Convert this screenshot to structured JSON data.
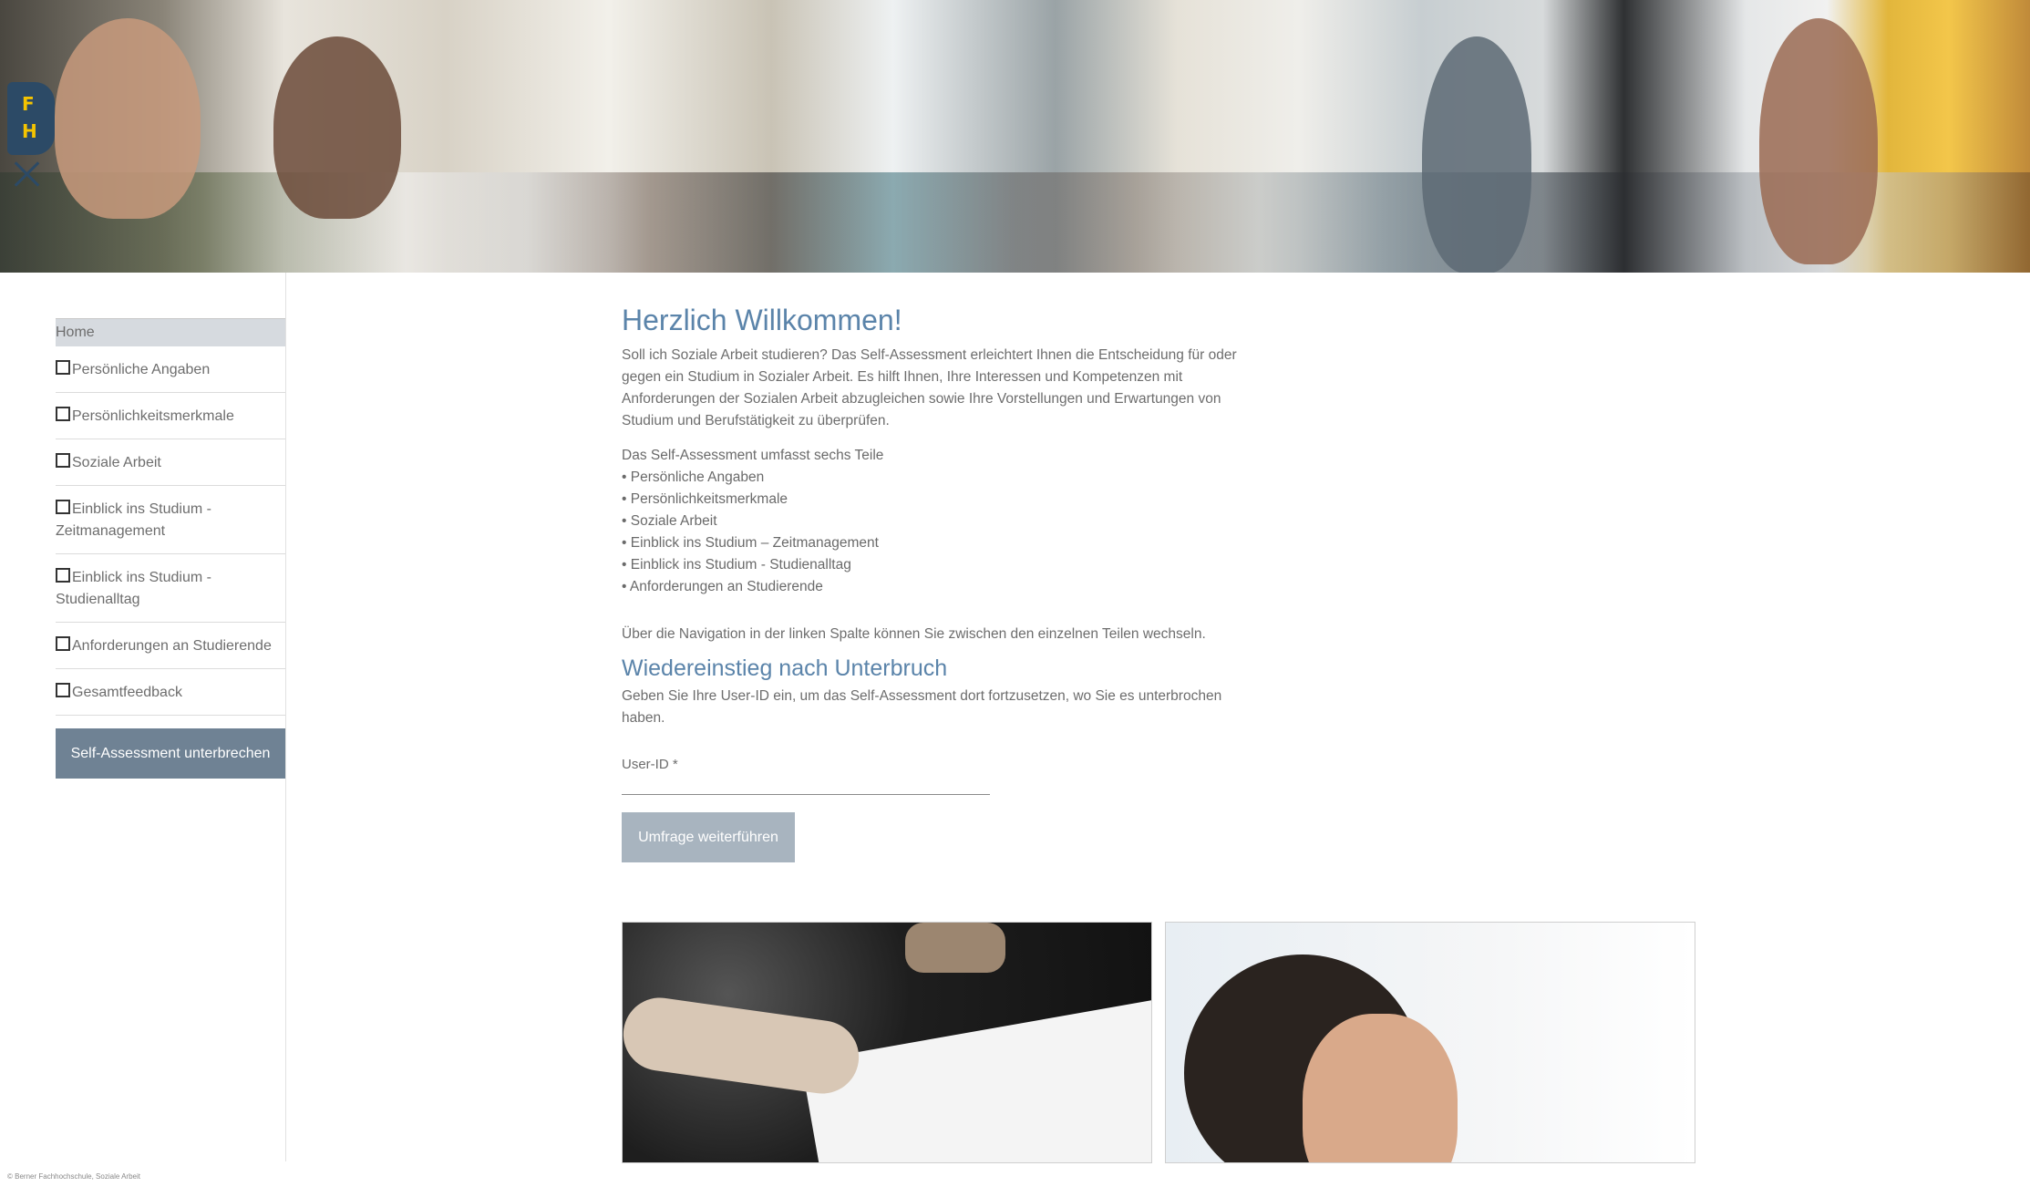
{
  "nav": {
    "home": "Home",
    "items": [
      {
        "label": "Persönliche Angaben"
      },
      {
        "label": "Persönlichkeitsmerkmale"
      },
      {
        "label": "Soziale Arbeit"
      },
      {
        "label": "Einblick ins Studium - Zeitmanagement"
      },
      {
        "label": "Einblick ins Studium - Studienalltag"
      },
      {
        "label": "Anforderungen an Studierende"
      },
      {
        "label": "Gesamtfeedback"
      }
    ],
    "pause_button": "Self-Assessment unterbrechen"
  },
  "logo": {
    "letter1": "F",
    "letter2": "H"
  },
  "main": {
    "title": "Herzlich Willkommen!",
    "intro": "Soll ich Soziale Arbeit studieren? Das Self-Assessment erleichtert Ihnen die Entscheidung für oder gegen ein Studium in Sozialer Arbeit. Es hilft Ihnen, Ihre Interessen und Kompetenzen mit Anforderungen der Sozialen Arbeit abzugleichen sowie Ihre Vorstellungen und Erwartungen von Studium und Berufstätigkeit zu überprüfen.",
    "parts_heading": "Das Self-Assessment umfasst sechs Teile",
    "parts": [
      "• Persönliche Angaben",
      "• Persönlichkeitsmerkmale",
      "• Soziale Arbeit",
      "• Einblick ins Studium – Zeitmanagement",
      "• Einblick ins Studium - Studienalltag",
      "• Anforderungen an Studierende"
    ],
    "nav_note": "Über die Navigation in der linken Spalte können Sie zwischen den einzelnen Teilen wechseln.",
    "reentry_title": "Wiedereinstieg nach Unterbruch",
    "reentry_text": "Geben Sie Ihre User-ID ein, um das Self-Assessment dort fortzusetzen, wo Sie es unterbrochen haben.",
    "userid_label": "User-ID *",
    "userid_value": "",
    "continue_button": "Umfrage weiterführen"
  },
  "footer": "© Berner Fachhochschule, Soziale Arbeit",
  "colors": {
    "accent": "#5b84aa",
    "button": "#6f8294",
    "button_disabled": "#a8b4bf",
    "logo_bg": "#2c4a66",
    "logo_text": "#f5c400"
  }
}
